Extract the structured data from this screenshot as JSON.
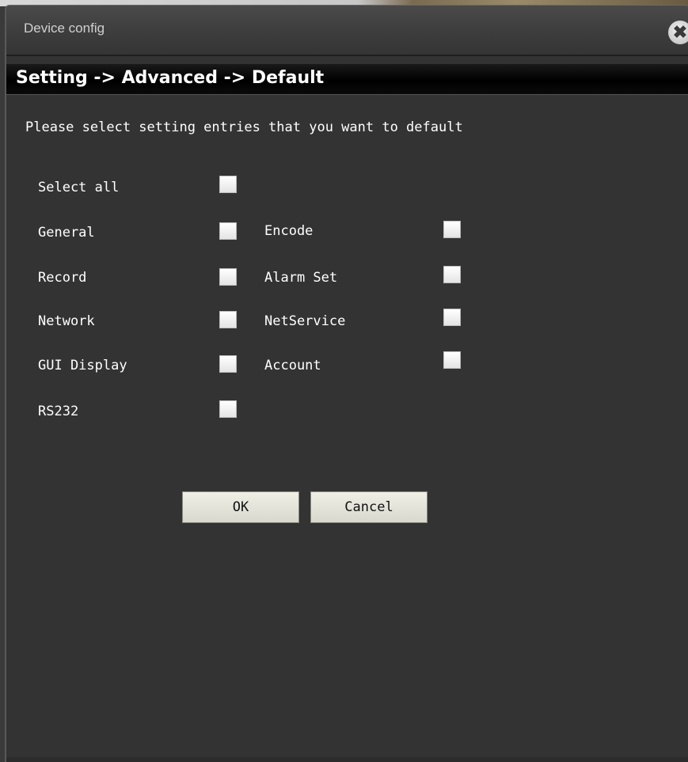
{
  "window": {
    "title": "Device config",
    "close_glyph": "✖",
    "close_icon": "close-circle-icon"
  },
  "breadcrumb": "Setting -> Advanced -> Default",
  "instruction": "Please select setting entries that you want to default",
  "options": {
    "select_all": {
      "label": "Select all",
      "checked": false
    },
    "general": {
      "label": "General",
      "checked": false
    },
    "encode": {
      "label": "Encode",
      "checked": false
    },
    "record": {
      "label": "Record",
      "checked": false
    },
    "alarm_set": {
      "label": "Alarm Set",
      "checked": false
    },
    "network": {
      "label": "Network",
      "checked": false
    },
    "netservice": {
      "label": "NetService",
      "checked": false
    },
    "gui_display": {
      "label": "GUI Display",
      "checked": false
    },
    "account": {
      "label": "Account",
      "checked": false
    },
    "rs232": {
      "label": "RS232",
      "checked": false
    }
  },
  "buttons": {
    "ok": "OK",
    "cancel": "Cancel"
  },
  "colors": {
    "panel": "#333333",
    "title_bar": "#3c3c3c",
    "breadcrumb_bar": "#000000",
    "text": "#ffffff",
    "button_face": "#e4e4da"
  }
}
